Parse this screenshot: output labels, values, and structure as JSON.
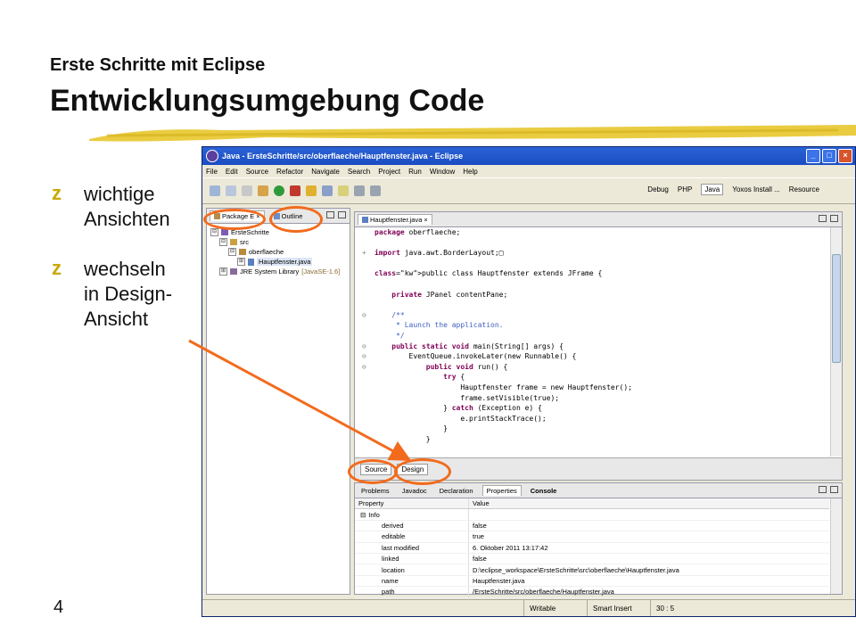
{
  "slide": {
    "subtitle": "Erste Schritte mit Eclipse",
    "title": "Entwicklungsumgebung Code",
    "bullets": [
      {
        "marker": "z",
        "text": "wichtige\nAnsichten"
      },
      {
        "marker": "z",
        "text": "wechseln\nin Design-\nAnsicht"
      }
    ],
    "page_number": "4",
    "accent_color": "#f26b1d"
  },
  "window": {
    "title": "Java - ErsteSchritte/src/oberflaeche/Hauptfenster.java - Eclipse",
    "buttons": [
      "_",
      "□",
      "×"
    ],
    "menu": [
      "File",
      "Edit",
      "Source",
      "Refactor",
      "Navigate",
      "Search",
      "Project",
      "Run",
      "Window",
      "Help"
    ],
    "perspectives": [
      "Debug",
      "PHP",
      "Java",
      "Yoxos Install ...",
      "Resource"
    ]
  },
  "explorer": {
    "tabs": [
      "Package E",
      "Outline"
    ],
    "tree": [
      {
        "label": "ErsteSchritte",
        "indent": 0,
        "toggle": "⊟"
      },
      {
        "label": "src",
        "indent": 1,
        "toggle": "⊟"
      },
      {
        "label": "oberflaeche",
        "indent": 2,
        "toggle": "⊟"
      },
      {
        "label": "Hauptfenster.java",
        "indent": 3,
        "toggle": "⊞"
      },
      {
        "label": "JRE System Library",
        "suffix": "[JavaSE-1.6]",
        "indent": 1,
        "toggle": "⊞"
      }
    ]
  },
  "editor": {
    "tab": "Hauptfenster.java",
    "lines": [
      {
        "code": "package oberflaeche;",
        "kw": "package"
      },
      {
        "code": "",
        "kw": ""
      },
      {
        "code": "import java.awt.BorderLayout;□",
        "kw": "import",
        "fold": "+"
      },
      {
        "code": "",
        "kw": ""
      },
      {
        "code": "public class Hauptfenster extends JFrame {",
        "kw": "public class"
      },
      {
        "code": "",
        "kw": ""
      },
      {
        "code": "    private JPanel contentPane;",
        "kw": "private"
      },
      {
        "code": "",
        "kw": ""
      },
      {
        "code": "    /**",
        "kw": "",
        "comment": true,
        "fold": "⊖"
      },
      {
        "code": "     * Launch the application.",
        "kw": "",
        "comment": true
      },
      {
        "code": "     */",
        "kw": "",
        "comment": true
      },
      {
        "code": "    public static void main(String[] args) {",
        "kw": "public static void",
        "fold": "⊖"
      },
      {
        "code": "        EventQueue.invokeLater(new Runnable() {",
        "kw": "",
        "fold": "⊖"
      },
      {
        "code": "            public void run() {",
        "kw": "public void",
        "fold": "⊖"
      },
      {
        "code": "                try {",
        "kw": "try"
      },
      {
        "code": "                    Hauptfenster frame = new Hauptfenster();",
        "kw": ""
      },
      {
        "code": "                    frame.setVisible(true);",
        "kw": ""
      },
      {
        "code": "                } catch (Exception e) {",
        "kw": "catch"
      },
      {
        "code": "                    e.printStackTrace();",
        "kw": ""
      },
      {
        "code": "                }",
        "kw": ""
      },
      {
        "code": "            }",
        "kw": ""
      }
    ],
    "bottom_tabs": [
      "Source",
      "Design"
    ]
  },
  "bottom": {
    "tabs": [
      "Problems",
      "Javadoc",
      "Declaration",
      "Properties",
      "Console"
    ],
    "columns": [
      "Property",
      "Value"
    ],
    "category": "Info",
    "rows": [
      [
        "derived",
        "false"
      ],
      [
        "editable",
        "true"
      ],
      [
        "last modified",
        "6. Oktober 2011 13:17:42"
      ],
      [
        "linked",
        "false"
      ],
      [
        "location",
        "D:\\eclipse_workspace\\ErsteSchritte\\src\\oberflaeche\\Hauptfenster.java"
      ],
      [
        "name",
        "Hauptfenster.java"
      ],
      [
        "path",
        "/ErsteSchritte/src/oberflaeche/Hauptfenster.java"
      ]
    ]
  },
  "status": {
    "mode": "Writable",
    "insert": "Smart Insert",
    "position": "30 : 5"
  }
}
